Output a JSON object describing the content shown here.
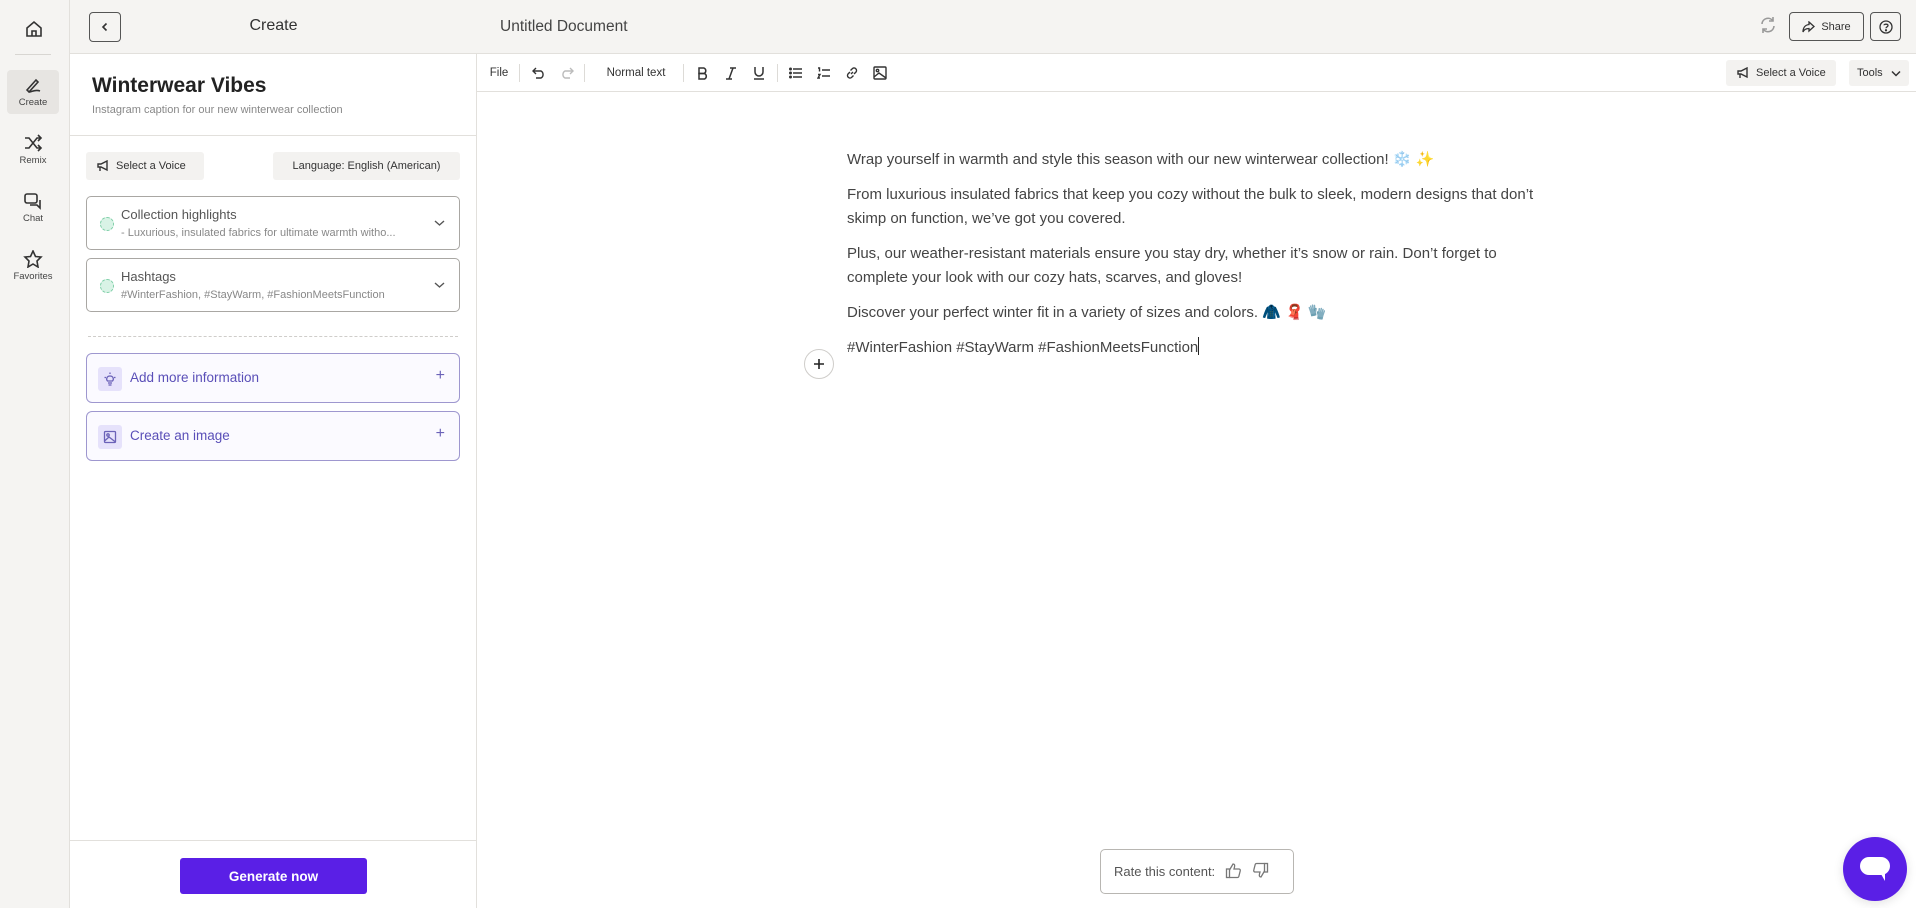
{
  "rail": {
    "items": [
      {
        "label": "Create",
        "icon": "pen-icon",
        "active": true
      },
      {
        "label": "Remix",
        "icon": "shuffle-icon",
        "active": false
      },
      {
        "label": "Chat",
        "icon": "chat-bubbles-icon",
        "active": false
      },
      {
        "label": "Favorites",
        "icon": "star-icon",
        "active": false
      }
    ]
  },
  "panel": {
    "header_title": "Create",
    "doc_title": "Winterwear Vibes",
    "doc_subtitle": "Instagram caption for our new winterwear collection",
    "voice_label": "Select a Voice",
    "language_label": "Language: English (American)",
    "cards": [
      {
        "title": "Collection highlights",
        "subtitle": "- Luxurious, insulated fabrics for ultimate warmth witho..."
      },
      {
        "title": "Hashtags",
        "subtitle": "#WinterFashion, #StayWarm, #FashionMeetsFunction"
      }
    ],
    "actions": [
      {
        "label": "Add more information",
        "icon": "lightbulb-icon"
      },
      {
        "label": "Create an image",
        "icon": "image-icon"
      }
    ],
    "generate_label": "Generate now"
  },
  "editor": {
    "document_name": "Untitled Document",
    "share_label": "Share",
    "toolbar": {
      "file_label": "File",
      "style_label": "Normal text",
      "voice_label": "Select a Voice",
      "tools_label": "Tools"
    },
    "paragraphs": [
      "Wrap yourself in warmth and style this season with our new winterwear collection! ❄️ ✨",
      "From luxurious insulated fabrics that keep you cozy without the bulk to sleek, modern designs that don’t skimp on function, we’ve got you covered.",
      "Plus, our weather-resistant materials ensure you stay dry, whether it’s snow or rain. Don’t forget to complete your look with our cozy hats, scarves, and gloves!",
      "Discover your perfect winter fit in a variety of sizes and colors. 🧥 🧣 🧤",
      "#WinterFashion #StayWarm #FashionMeetsFunction"
    ],
    "rate_label": "Rate this content:"
  },
  "colors": {
    "accent": "#5a1fe6",
    "action_text": "#5a4fb8",
    "action_border": "#9e97cf",
    "status_dot": "#d9f3e6"
  }
}
